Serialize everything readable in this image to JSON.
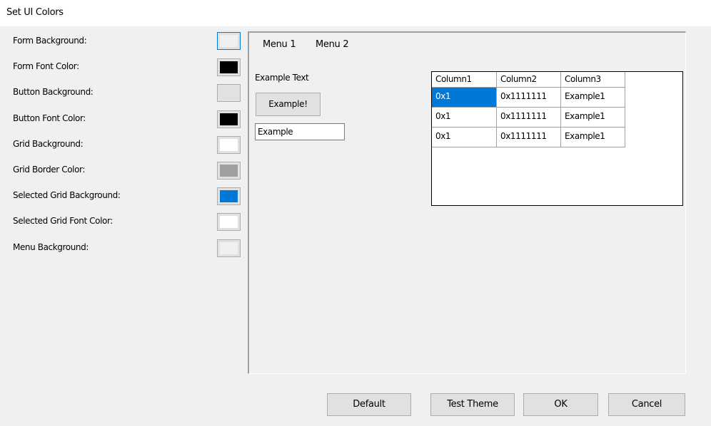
{
  "window": {
    "title": "Set UI Colors"
  },
  "settings": [
    {
      "label": "Form Background:",
      "swatch_color": "#f0f0f0",
      "focused": true
    },
    {
      "label": "Form Font Color:",
      "swatch_color": "#000000"
    },
    {
      "label": "Button Background:",
      "swatch_color": "#e1e1e1"
    },
    {
      "label": "Button Font Color:",
      "swatch_color": "#000000"
    },
    {
      "label": "Grid Background:",
      "swatch_color": "#ffffff"
    },
    {
      "label": "Grid Border Color:",
      "swatch_color": "#a0a0a0"
    },
    {
      "label": "Selected Grid Background:",
      "swatch_color": "#0078d7"
    },
    {
      "label": "Selected Grid Font Color:",
      "swatch_color": "#ffffff"
    },
    {
      "label": "Menu Background:",
      "swatch_color": "#f0f0f0"
    }
  ],
  "preview": {
    "menu": [
      "Menu 1",
      "Menu 2"
    ],
    "example_text": "Example Text",
    "example_button": "Example!",
    "example_input": "Example",
    "grid": {
      "columns": [
        "Column1",
        "Column2",
        "Column3"
      ],
      "rows": [
        [
          "0x1",
          "0x1111111",
          "Example1"
        ],
        [
          "0x1",
          "0x1111111",
          "Example1"
        ],
        [
          "0x1",
          "0x1111111",
          "Example1"
        ]
      ],
      "selected_cell": "row 1, column 1"
    }
  },
  "buttons": {
    "default": "Default",
    "test_theme": "Test Theme",
    "ok": "OK",
    "cancel": "Cancel"
  }
}
